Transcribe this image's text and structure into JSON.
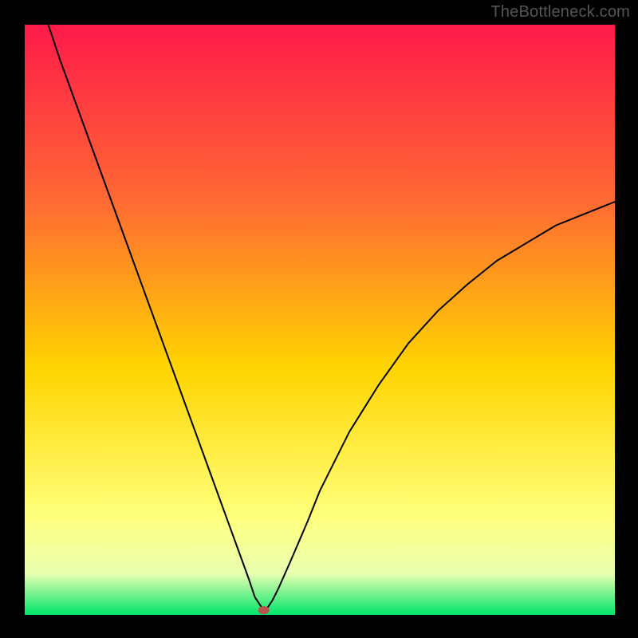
{
  "watermark": "TheBottleneck.com",
  "colors": {
    "background": "#000000",
    "gradient_top": "#ff1a4a",
    "gradient_mid_upper": "#ff6a33",
    "gradient_mid": "#ffd400",
    "gradient_lower": "#ffff7a",
    "gradient_low2": "#e9ffb0",
    "gradient_bottom": "#00e56a",
    "curve": "#000000",
    "dot": "#b9534b"
  },
  "chart_data": {
    "type": "line",
    "title": "",
    "xlabel": "",
    "ylabel": "",
    "xlim": [
      0,
      100
    ],
    "ylim": [
      0,
      100
    ],
    "series": [
      {
        "name": "left-branch",
        "x": [
          4,
          6,
          8,
          10,
          12,
          14,
          16,
          18,
          20,
          22,
          24,
          26,
          28,
          30,
          32,
          34,
          36,
          38,
          39,
          40,
          40.5
        ],
        "y": [
          100,
          94,
          88.5,
          83,
          77.5,
          72,
          66.5,
          61,
          55.5,
          50,
          44.5,
          39,
          33.5,
          28,
          22.5,
          17,
          11.5,
          6,
          3,
          1.5,
          0.8
        ]
      },
      {
        "name": "right-branch",
        "x": [
          40.5,
          41,
          42,
          43,
          45,
          48,
          50,
          55,
          60,
          65,
          70,
          75,
          80,
          85,
          90,
          95,
          100
        ],
        "y": [
          0.8,
          1,
          2.5,
          4.5,
          9,
          16,
          21,
          31,
          39,
          46,
          51.5,
          56,
          60,
          63,
          66,
          68,
          70
        ]
      }
    ],
    "annotations": [
      {
        "name": "optimum-dot",
        "x": 40.5,
        "y": 0.8
      }
    ],
    "legend": false,
    "grid": false
  }
}
